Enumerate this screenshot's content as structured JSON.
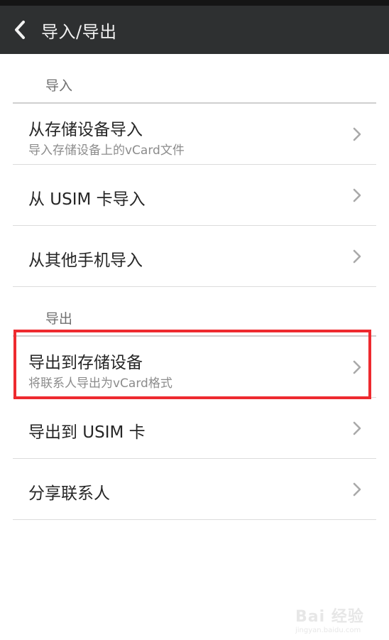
{
  "header": {
    "title": "导入/导出"
  },
  "sections": {
    "import_label": "导入",
    "export_label": "导出"
  },
  "items": [
    {
      "title": "从存储设备导入",
      "subtitle": "导入存储设备上的vCard文件"
    },
    {
      "title": "从 USIM 卡导入"
    },
    {
      "title": "从其他手机导入"
    },
    {
      "title": "导出到存储设备",
      "subtitle": "将联系人导出为vCard格式"
    },
    {
      "title": "导出到 USIM 卡"
    },
    {
      "title": "分享联系人"
    }
  ],
  "watermark": {
    "main": "Bai 经验",
    "sub": "jingyan.baidu.com"
  },
  "colors": {
    "header_bg": "#2e3031",
    "highlight": "#ee2a2f"
  }
}
